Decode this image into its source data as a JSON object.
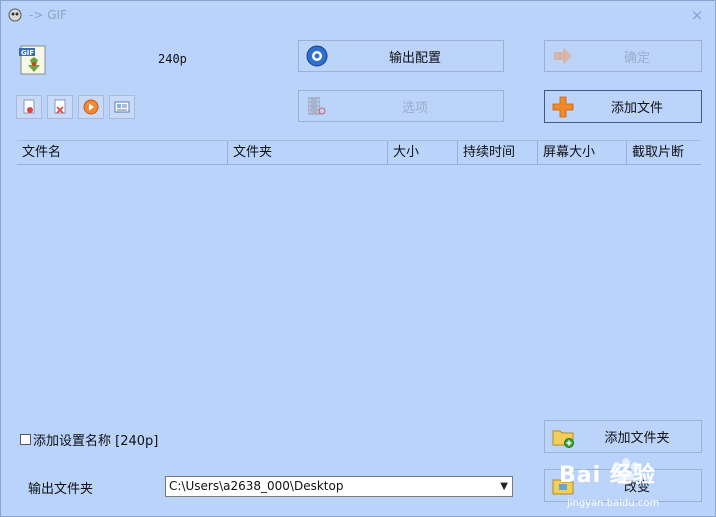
{
  "window": {
    "title": "-> GIF",
    "close_glyph": "×"
  },
  "profile_label": "240p",
  "buttons": {
    "output_config": "输出配置",
    "confirm": "确定",
    "options": "选项",
    "add_file": "添加文件",
    "add_folder": "添加文件夹",
    "change": "改变"
  },
  "toolbar": [
    {
      "name": "remove-file",
      "icon": "page-minus-icon"
    },
    {
      "name": "clear-list",
      "icon": "page-x-icon"
    },
    {
      "name": "play",
      "icon": "play-icon"
    },
    {
      "name": "media-info",
      "icon": "info-card-icon"
    }
  ],
  "list": {
    "columns": [
      "文件名",
      "文件夹",
      "大小",
      "持续时间",
      "屏幕大小",
      "截取片断"
    ],
    "rows": []
  },
  "add_setting_name": {
    "label": "添加设置名称 [240p]",
    "checked": false
  },
  "output_folder": {
    "label": "输出文件夹",
    "value": "C:\\Users\\a2638_000\\Desktop"
  },
  "watermark": {
    "text": "Bai 经验",
    "sub": "jingyan.baidu.com"
  }
}
